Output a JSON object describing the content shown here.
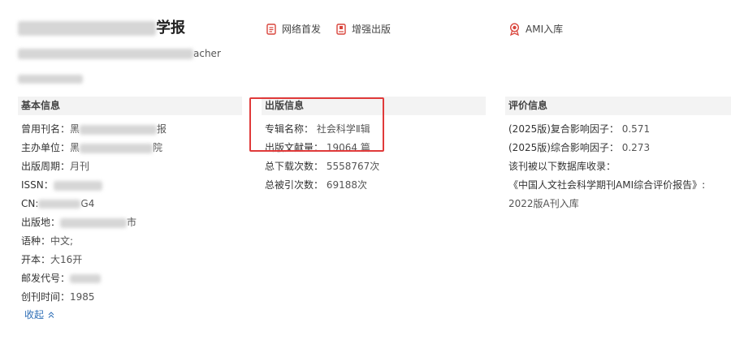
{
  "header": {
    "title_suffix": "学报",
    "subtitle_suffix": "acher"
  },
  "top_links": [
    {
      "label": "网络首发",
      "icon": "document-icon"
    },
    {
      "label": "增强出版",
      "icon": "book-icon"
    },
    {
      "label": "AMI入库",
      "icon": "award-ribbon-icon"
    }
  ],
  "basic_info": {
    "header": "基本信息",
    "former_name_label": "曾用刊名：",
    "former_name_visible": "黑",
    "former_name_end": "报",
    "sponsor_label": "主办单位：",
    "sponsor_visible": "黑",
    "sponsor_end": "院",
    "period_label": "出版周期：",
    "period_value": "月刊",
    "issn_label": "ISSN：",
    "cn_label": "CN:",
    "cn_end": "G4",
    "place_label": "出版地：",
    "place_end": "市",
    "language_label": "语种：",
    "language_value": "中文;",
    "format_label": "开本：",
    "format_value": "大16开",
    "postal_label": "邮发代号：",
    "founded_label": "创刊时间：",
    "founded_value": "1985",
    "collapse_label": "收起",
    "collapse_icon": "double-chevron-up-icon"
  },
  "publish_info": {
    "header": "出版信息",
    "series_label": "专辑名称：",
    "series_value": "社会科学Ⅱ辑",
    "volume_label": "出版文献量：",
    "volume_value": "19064 篇",
    "downloads_label": "总下载次数：",
    "downloads_value": "5558767次",
    "citations_label": "总被引次数：",
    "citations_value": "69188次"
  },
  "evaluation": {
    "header": "评价信息",
    "composite_label": "(2025版)复合影响因子：",
    "composite_value": "0.571",
    "comprehensive_label": "(2025版)综合影响因子：",
    "comprehensive_value": "0.273",
    "db_label": "该刊被以下数据库收录：",
    "db_report": "《中国人文社会科学期刊AMI综合评价报告》:",
    "db_level": "2022版A刊入库"
  },
  "colors": {
    "highlight_box": "#e03a3a",
    "link": "#2f6fb6",
    "icon_red": "#d9453c",
    "section_bg": "#f3f3f3"
  }
}
